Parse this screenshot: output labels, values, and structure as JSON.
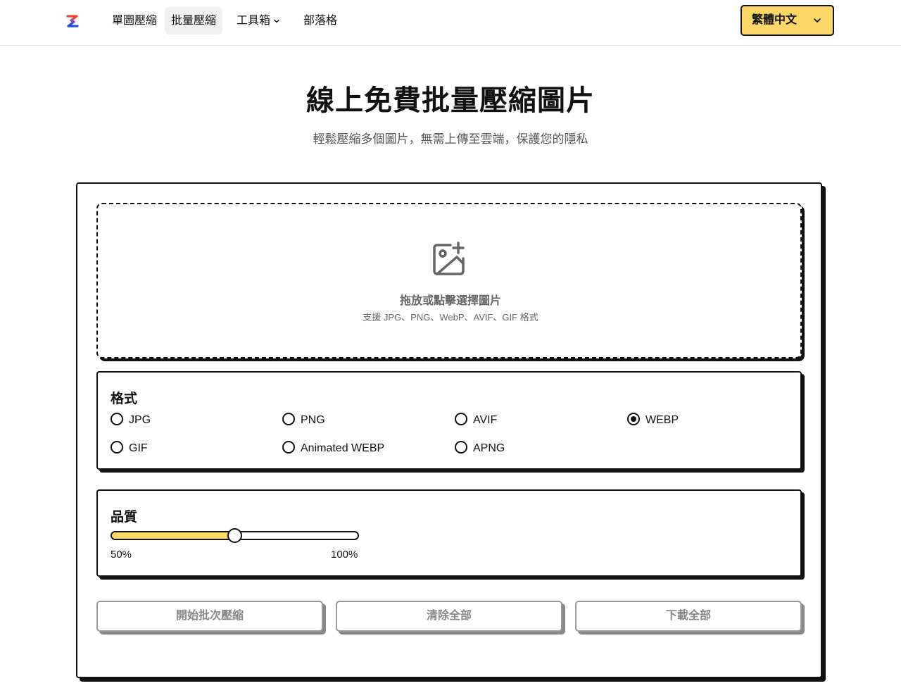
{
  "brand": {
    "logo_icon": "logo-z-icon",
    "colors": [
      "#1f4fd8",
      "#e8463a"
    ]
  },
  "nav": {
    "items": [
      {
        "label": "單圖壓縮"
      },
      {
        "label": "批量壓縮"
      },
      {
        "label": "工具箱"
      },
      {
        "label": "部落格"
      }
    ],
    "active": "批量壓縮",
    "dropdown_icon": "chevron-down-icon"
  },
  "language": {
    "label": "繁體中文",
    "accent": "#fcd767"
  },
  "hero": {
    "title": "線上免費批量壓縮圖片",
    "subtitle": "輕鬆壓縮多個圖片，無需上傳至雲端，保護您的隱私"
  },
  "dropzone": {
    "icon": "image-add-icon",
    "title": "拖放或點擊選擇圖片",
    "subtitle": "支援 JPG、PNG、WebP、AVIF、GIF 格式"
  },
  "format": {
    "title": "格式",
    "options": [
      "JPG",
      "PNG",
      "AVIF",
      "WEBP",
      "GIF",
      "Animated WEBP",
      "APNG"
    ],
    "selected": "WEBP"
  },
  "quality": {
    "title": "品質",
    "value": 0.5,
    "min_label": "50%",
    "max_label": "100%",
    "fill_color": "#fcd767"
  },
  "actions": {
    "start": "開始批次壓縮",
    "clear": "清除全部",
    "download": "下載全部"
  }
}
